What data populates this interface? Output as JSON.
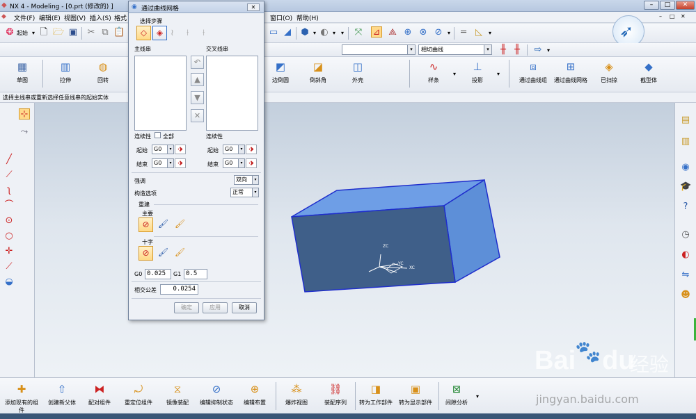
{
  "window": {
    "title": "NX 4 - Modeling - [0.prt  (修改的) ]",
    "min": "–",
    "max": "□",
    "close": "✕",
    "doc_min": "–",
    "doc_max": "□",
    "doc_close": "✕"
  },
  "menubar": {
    "items": [
      "文件(F)",
      "编辑(E)",
      "视图(V)",
      "插入(S)",
      "格式",
      "窗口(O)",
      "帮助(H)"
    ]
  },
  "standard_toolbar": {
    "start_label": "起始",
    "filter_combo": "",
    "curve_rule_combo": "相切曲线"
  },
  "feature_toolbar": {
    "left": [
      "草图",
      "拉伸",
      "回转"
    ],
    "middle": [
      "边倒圆",
      "倒斜角",
      "外壳"
    ],
    "right": [
      "样条",
      "投影",
      "通过曲线组",
      "通过曲线网格",
      "已扫掠",
      "截型体"
    ]
  },
  "status": {
    "prompt": "选择主线串或重新选择任意线串的起始实体"
  },
  "dialog": {
    "title": "通过曲线网格",
    "steps_label": "选择步骤",
    "primary_label": "主线串",
    "cross_label": "交叉线串",
    "continuity_label": "连续性",
    "all_label": "全部",
    "start_label": "起始",
    "end_label": "结束",
    "start_value": "G0",
    "end_value": "G0",
    "cross_start_label": "起始",
    "cross_end_label": "结束",
    "cross_start_value": "G0",
    "cross_end_value": "G0",
    "emphasis_label": "强调",
    "emphasis_value": "双向",
    "construction_label": "构造选项",
    "construction_value": "正常",
    "rebuild_label": "重建",
    "primary_group_label": "主要",
    "cross_group_label": "十字",
    "g0_label": "G0",
    "g0_value": "0.025",
    "g1_label": "G1",
    "g1_value": "0.5",
    "tolerance_label": "相交公差",
    "tolerance_value": "0.0254",
    "ok": "确定",
    "apply": "应用",
    "cancel": "取消"
  },
  "viewport": {
    "axis_z": "ZC",
    "axis_y": "YC",
    "axis_x": "XC"
  },
  "assembly_toolbar": {
    "items": [
      "添加现有的组件",
      "创建新父体",
      "配对组件",
      "重定位组件",
      "镜像装配",
      "编辑抑制状态",
      "编辑布置",
      "爆炸视图",
      "装配序列",
      "转为工作部件",
      "转为显示部件",
      "间隙分析"
    ]
  },
  "watermark": {
    "brand": "Bai",
    "brand2": "du",
    "cn": "经验",
    "url": "jingyan.baidu.com"
  },
  "colors": {
    "solid_top": "#6e9ee6",
    "solid_front": "#3f5f89",
    "solid_side": "#5d8fd8",
    "edge": "#1f2ecc"
  }
}
